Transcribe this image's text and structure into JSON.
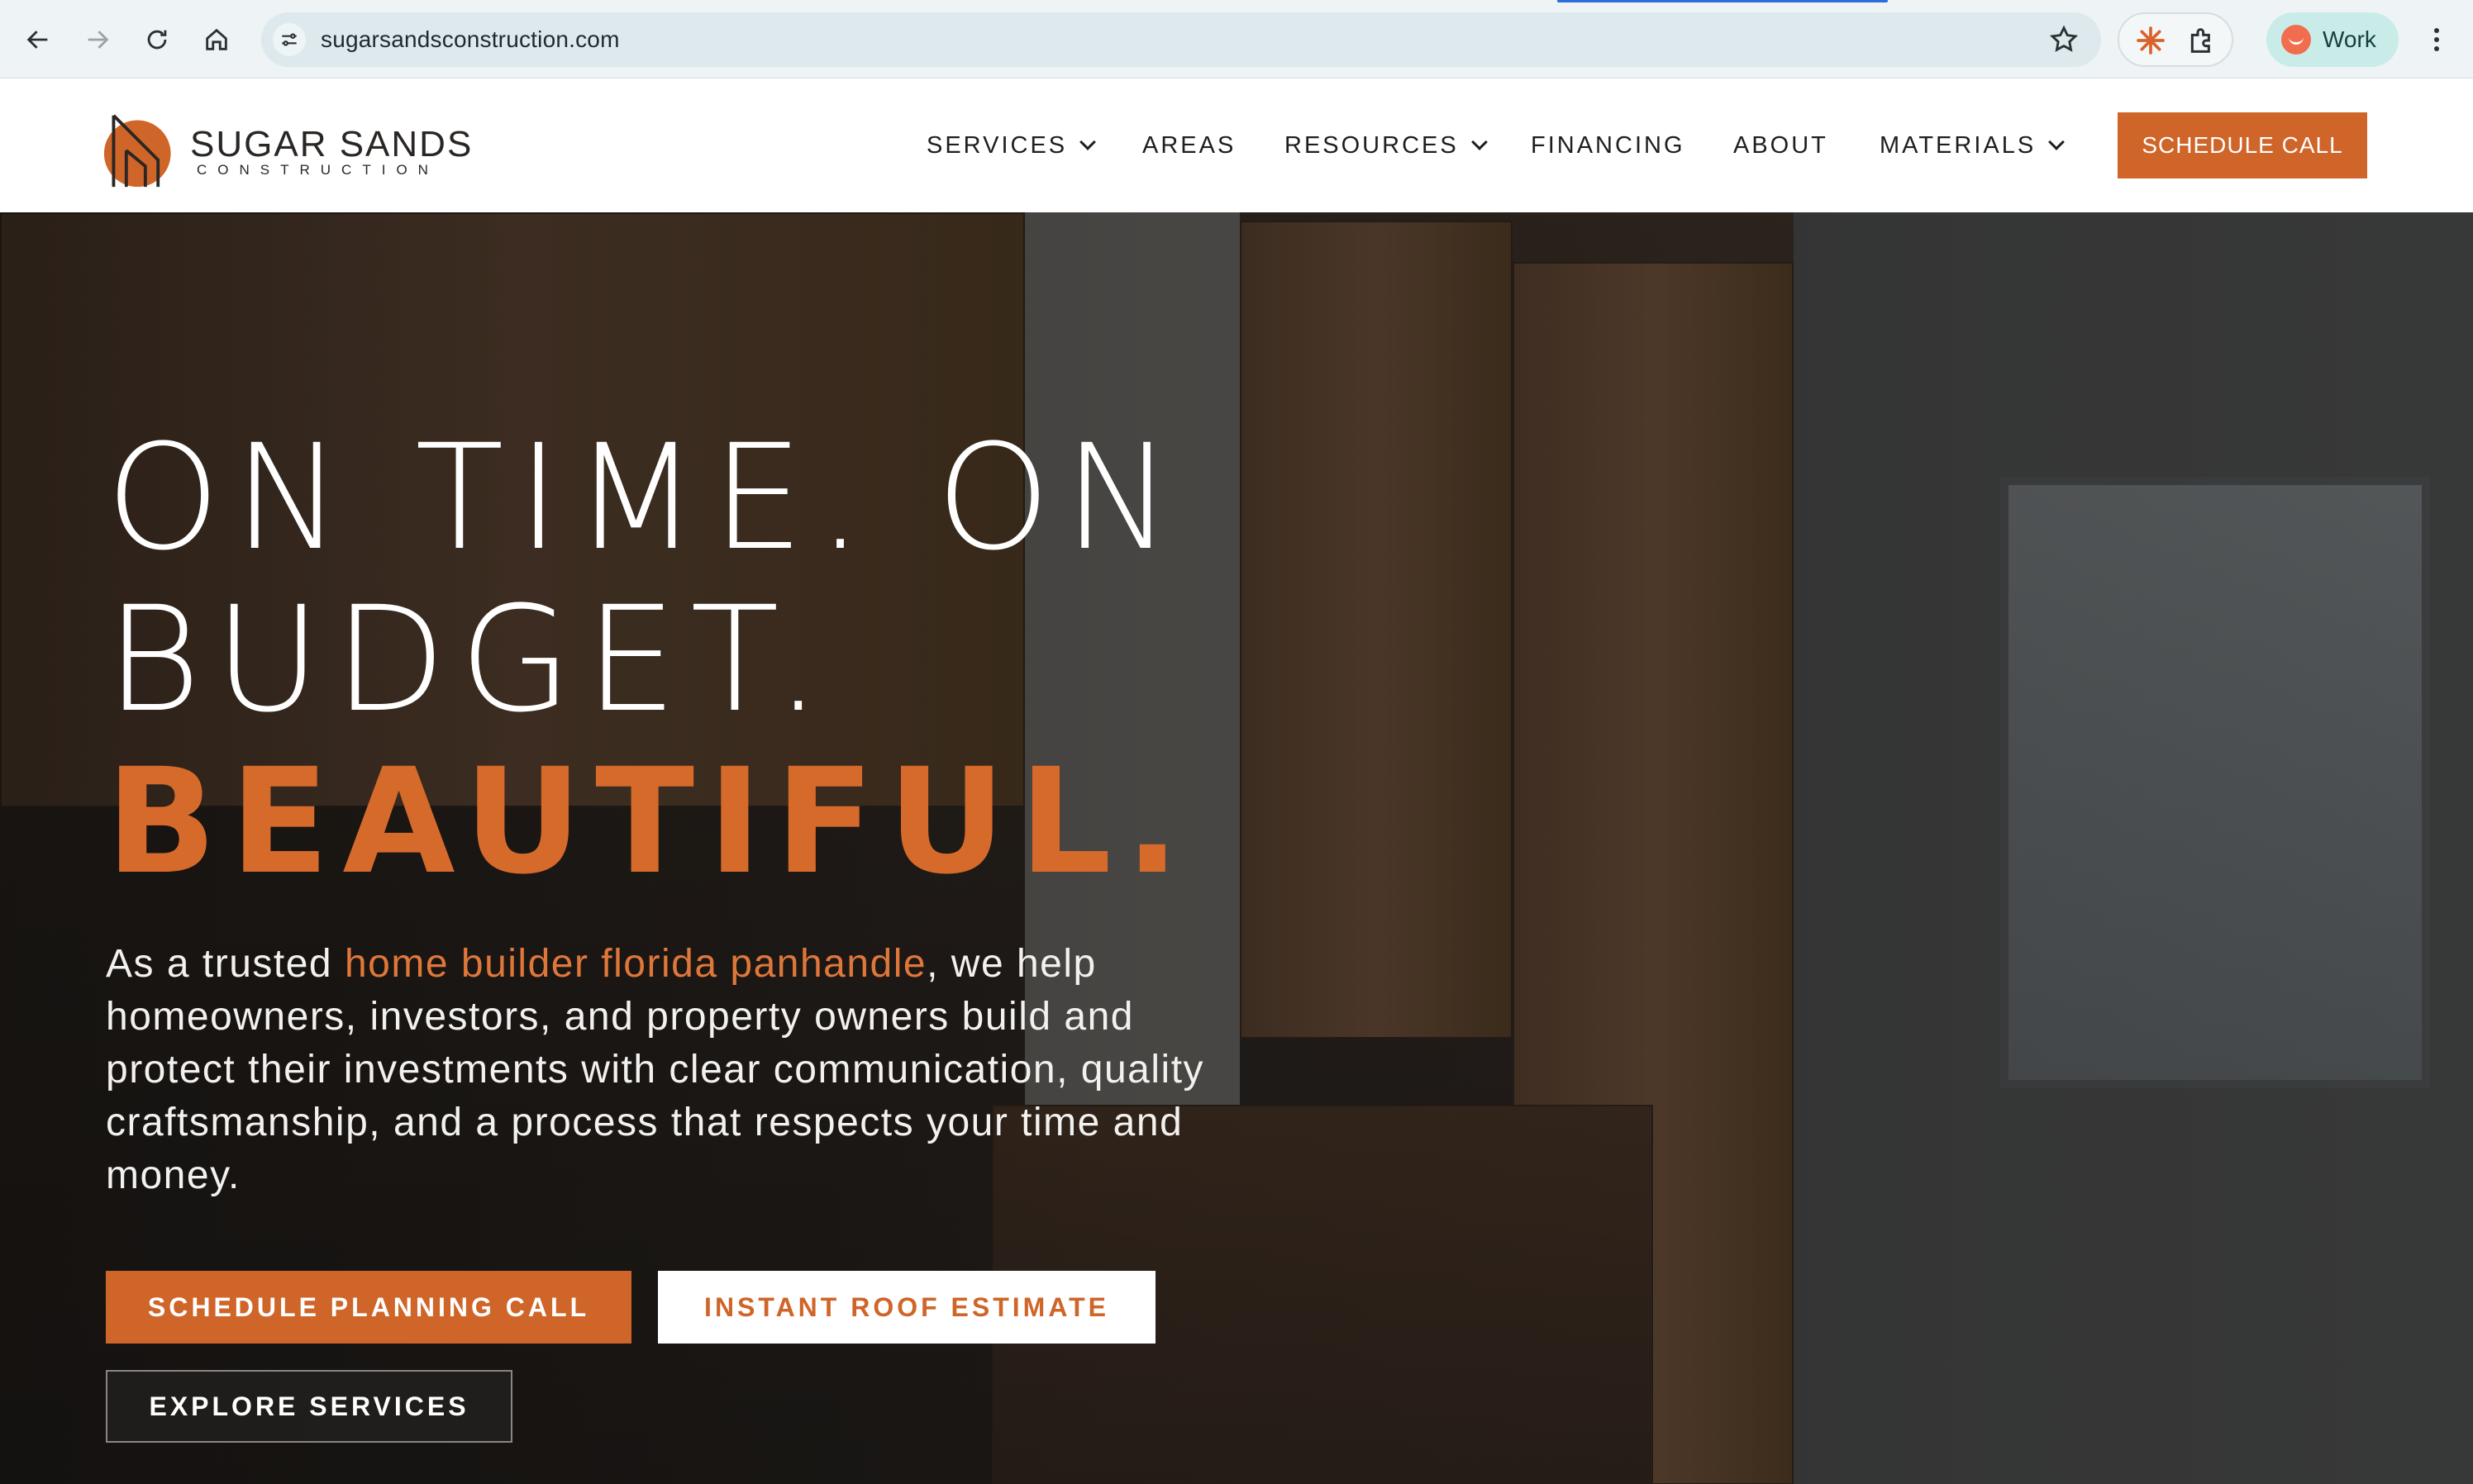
{
  "browser": {
    "url": "sugarsandsconstruction.com",
    "profile_label": "Work"
  },
  "site": {
    "logo_name": "SUGAR SANDS",
    "logo_sub": "CONSTRUCTION",
    "nav": [
      {
        "label": "SERVICES",
        "has_dropdown": true
      },
      {
        "label": "AREAS",
        "has_dropdown": false
      },
      {
        "label": "RESOURCES",
        "has_dropdown": true
      },
      {
        "label": "FINANCING",
        "has_dropdown": false
      },
      {
        "label": "ABOUT",
        "has_dropdown": false
      },
      {
        "label": "MATERIALS",
        "has_dropdown": true
      }
    ],
    "header_cta": "SCHEDULE CALL",
    "accent_color": "#cf6528"
  },
  "hero": {
    "line1": "ON TIME. ON",
    "line2": "BUDGET.",
    "line3": "BEAUTIFUL.",
    "lead_pre": "As a trusted ",
    "lead_link": "home builder florida panhandle",
    "lead_post": ", we help homeowners, investors, and property owners build and protect their investments with clear communication, quality craftsmanship, and a process that respects your time and money.",
    "btn_primary": "SCHEDULE PLANNING CALL",
    "btn_secondary": "INSTANT ROOF ESTIMATE",
    "btn_tertiary": "EXPLORE SERVICES"
  }
}
